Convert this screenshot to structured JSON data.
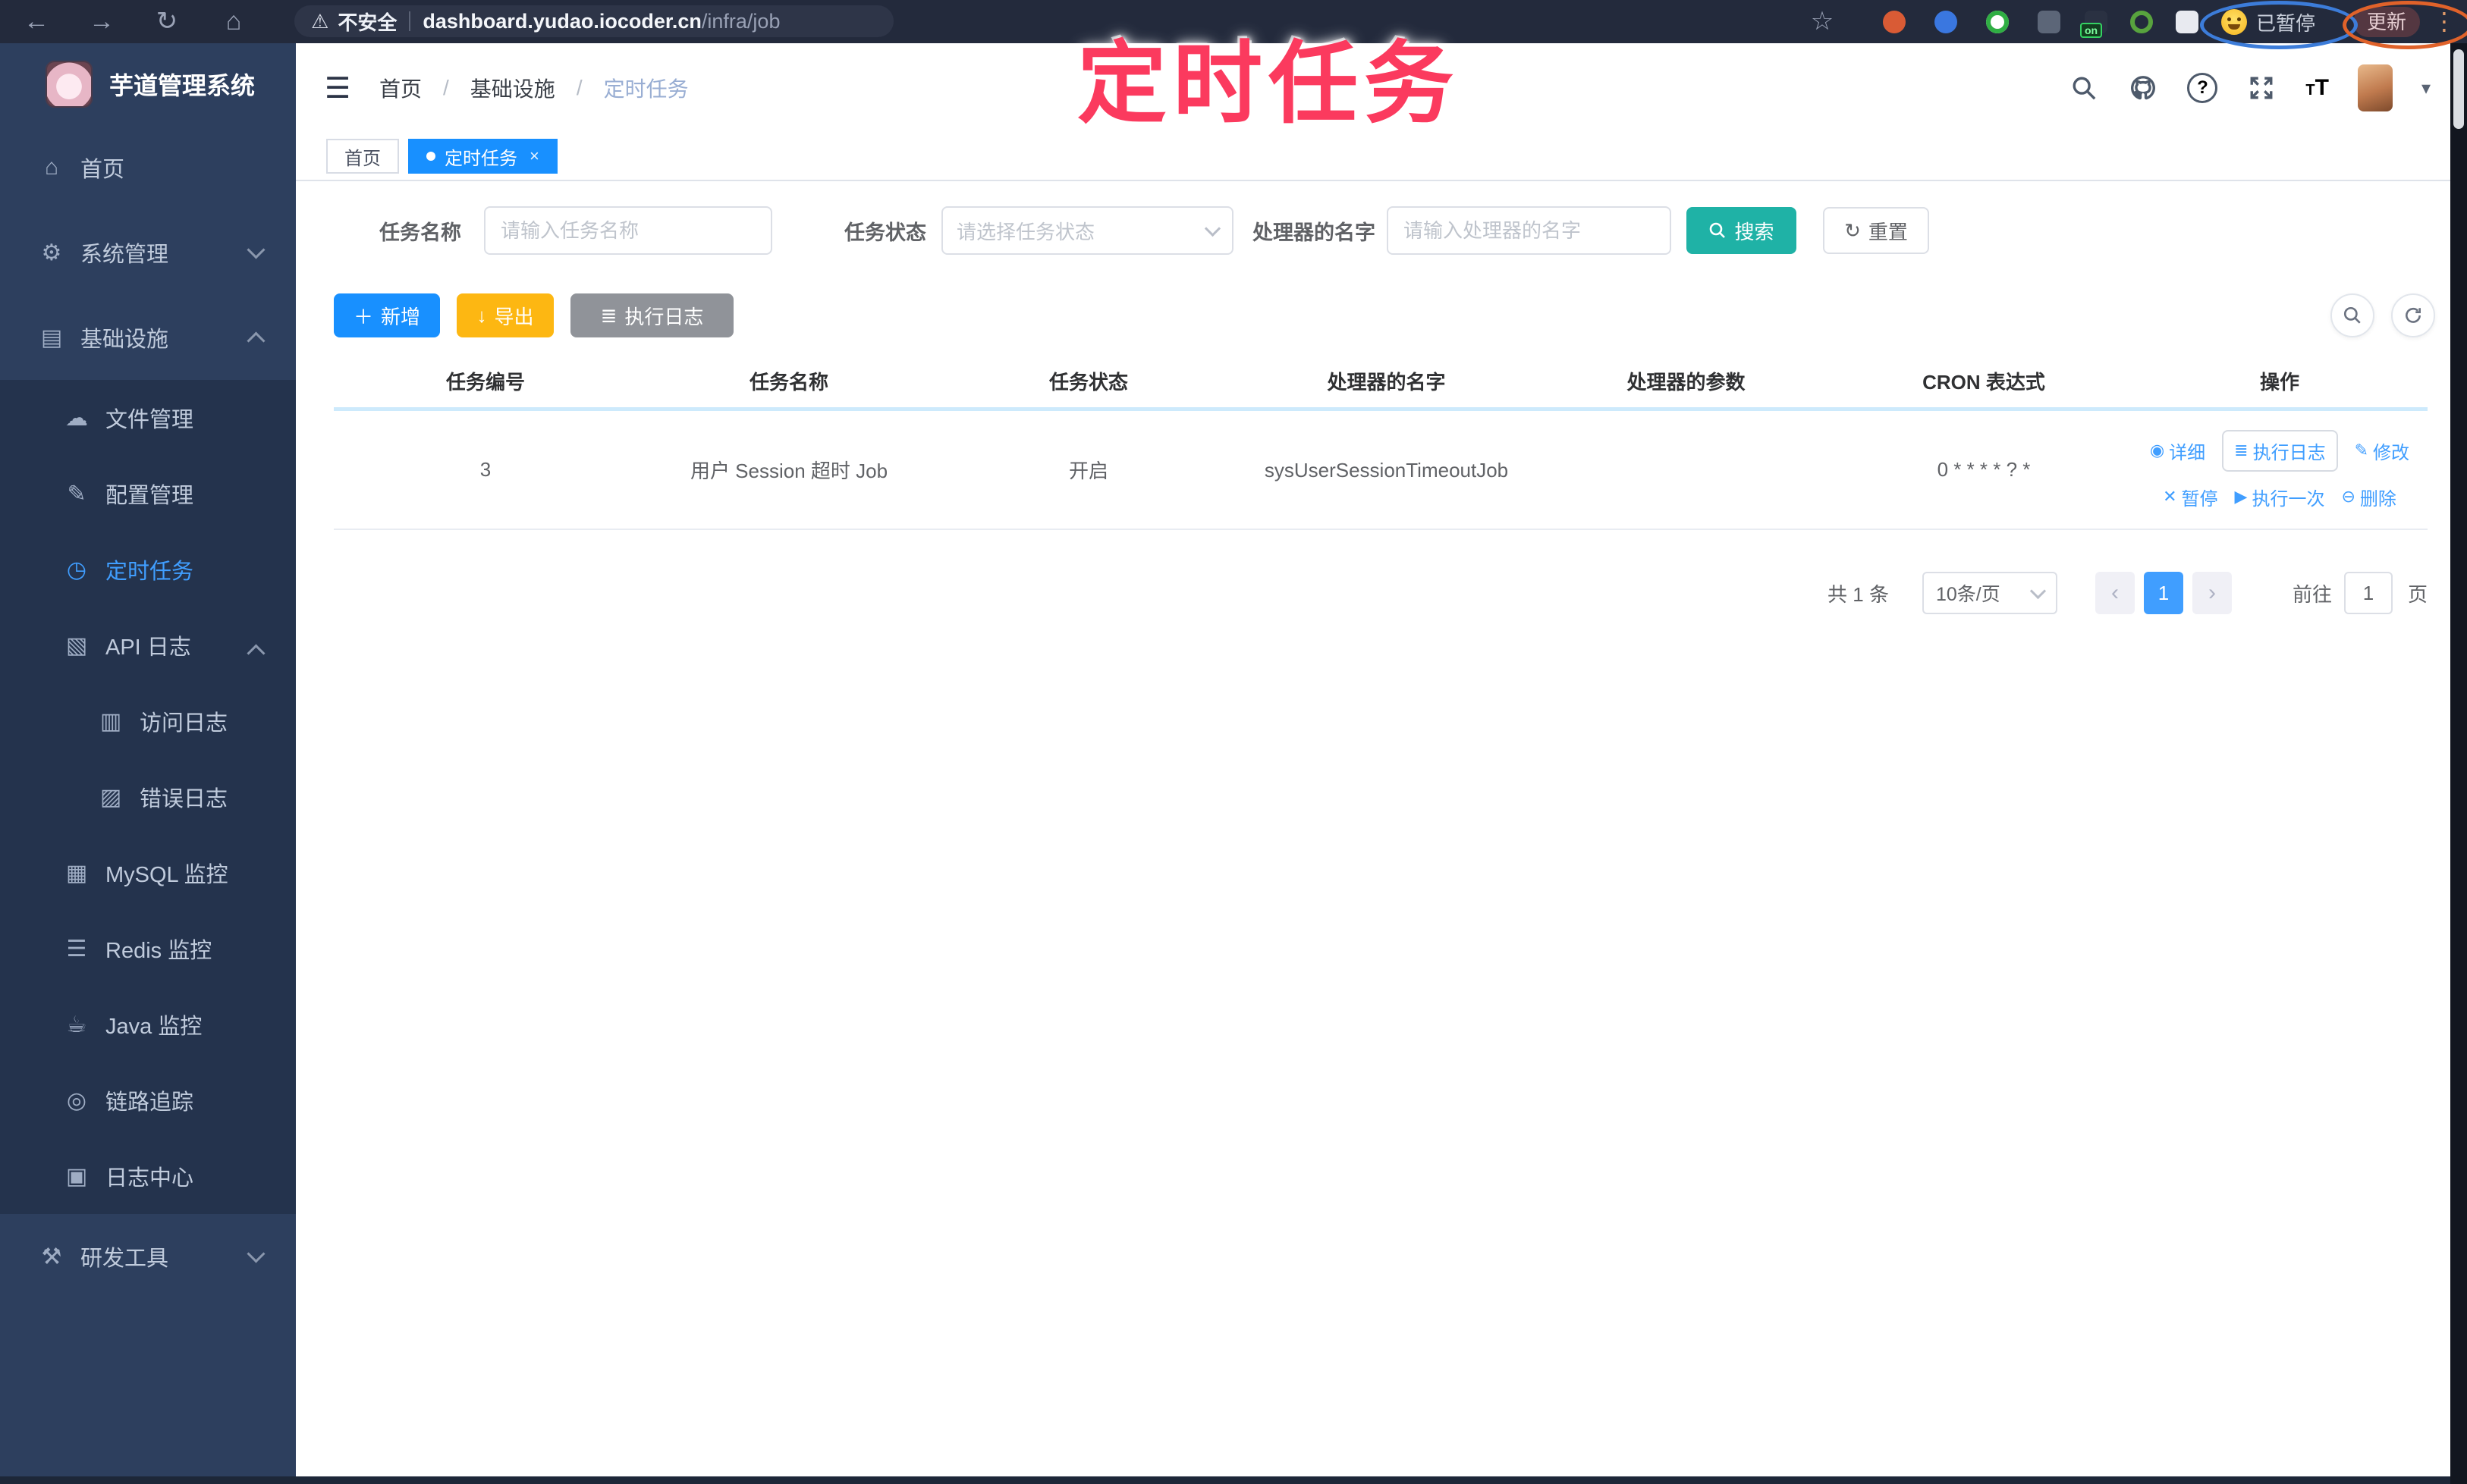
{
  "browser": {
    "security": "不安全",
    "url_host": "dashboard.yudao.iocoder.cn",
    "url_path": "/infra/job",
    "ext_on_badge": "on",
    "paused_badge": "已暂停",
    "update_button": "更新"
  },
  "overlay_title": "定时任务",
  "icons": {
    "back": "←",
    "forward": "→",
    "reload": "↻",
    "home_nav": "⌂",
    "star": "☆",
    "kebab": "⋮",
    "warning": "⚠",
    "home": "⌂",
    "system": "⚙",
    "infra": "▤",
    "file": "☁",
    "config": "✎",
    "job": "◷",
    "api": "▧",
    "access": "▥",
    "error": "▨",
    "mysql": "▦",
    "redis": "☰",
    "java": "☕",
    "trace": "◎",
    "logcenter": "▣",
    "tools": "⚒",
    "detail": "◉",
    "exec_log": "≣",
    "edit": "✎",
    "pause": "✕",
    "run_once": "▶",
    "delete": "⊖",
    "add": "＋",
    "export": "↓",
    "toolbar_log": "≣",
    "close": "×",
    "caret": "▾",
    "prev": "‹",
    "next": "›",
    "fontsize_big": "T",
    "fontsize_small": "T",
    "help": "?"
  },
  "sidebar": {
    "logo_title": "芋道管理系统",
    "items": [
      {
        "label": "首页"
      },
      {
        "label": "系统管理"
      },
      {
        "label": "基础设施"
      },
      {
        "label": "文件管理"
      },
      {
        "label": "配置管理"
      },
      {
        "label": "定时任务"
      },
      {
        "label": "API 日志"
      },
      {
        "label": "访问日志"
      },
      {
        "label": "错误日志"
      },
      {
        "label": "MySQL 监控"
      },
      {
        "label": "Redis 监控"
      },
      {
        "label": "Java 监控"
      },
      {
        "label": "链路追踪"
      },
      {
        "label": "日志中心"
      },
      {
        "label": "研发工具"
      }
    ]
  },
  "header": {
    "breadcrumb": [
      "首页",
      "基础设施",
      "定时任务"
    ],
    "separator": "/"
  },
  "tabs": [
    {
      "label": "首页"
    },
    {
      "label": "定时任务"
    }
  ],
  "filters": {
    "name_label": "任务名称",
    "name_placeholder": "请输入任务名称",
    "status_label": "任务状态",
    "status_placeholder": "请选择任务状态",
    "handler_label": "处理器的名字",
    "handler_placeholder": "请输入处理器的名字",
    "search_label": "搜索",
    "reset_label": "重置"
  },
  "toolbar": {
    "add_label": "新增",
    "export_label": "导出",
    "exec_log_label": "执行日志"
  },
  "table": {
    "columns": [
      "任务编号",
      "任务名称",
      "任务状态",
      "处理器的名字",
      "处理器的参数",
      "CRON 表达式",
      "操作"
    ],
    "row": {
      "id": "3",
      "name": "用户 Session 超时 Job",
      "status": "开启",
      "handler": "sysUserSessionTimeoutJob",
      "param": "",
      "cron": "0 * * * * ? *",
      "actions": {
        "detail": "详细",
        "exec_log": "执行日志",
        "edit": "修改",
        "pause": "暂停",
        "run_once": "执行一次",
        "delete": "删除"
      }
    }
  },
  "pagination": {
    "total": "共 1 条",
    "page_size": "10条/页",
    "current": "1",
    "goto_label": "前往",
    "goto_value": "1",
    "page_label": "页"
  },
  "colors": {
    "primary_link": "#409eff",
    "tab_active": "#1890ff",
    "add_blue": "#1890ff",
    "export_yellow": "#fdb712",
    "info_gray": "#909399",
    "search_teal": "#1fb2a6",
    "overlay_pink": "#fb3a5e",
    "sidebar_bg": "#2d3f5e",
    "submenu_bg": "#24334d",
    "browser_bar_bg": "#232a3c",
    "header_underline_blue": "#cdeafc"
  }
}
